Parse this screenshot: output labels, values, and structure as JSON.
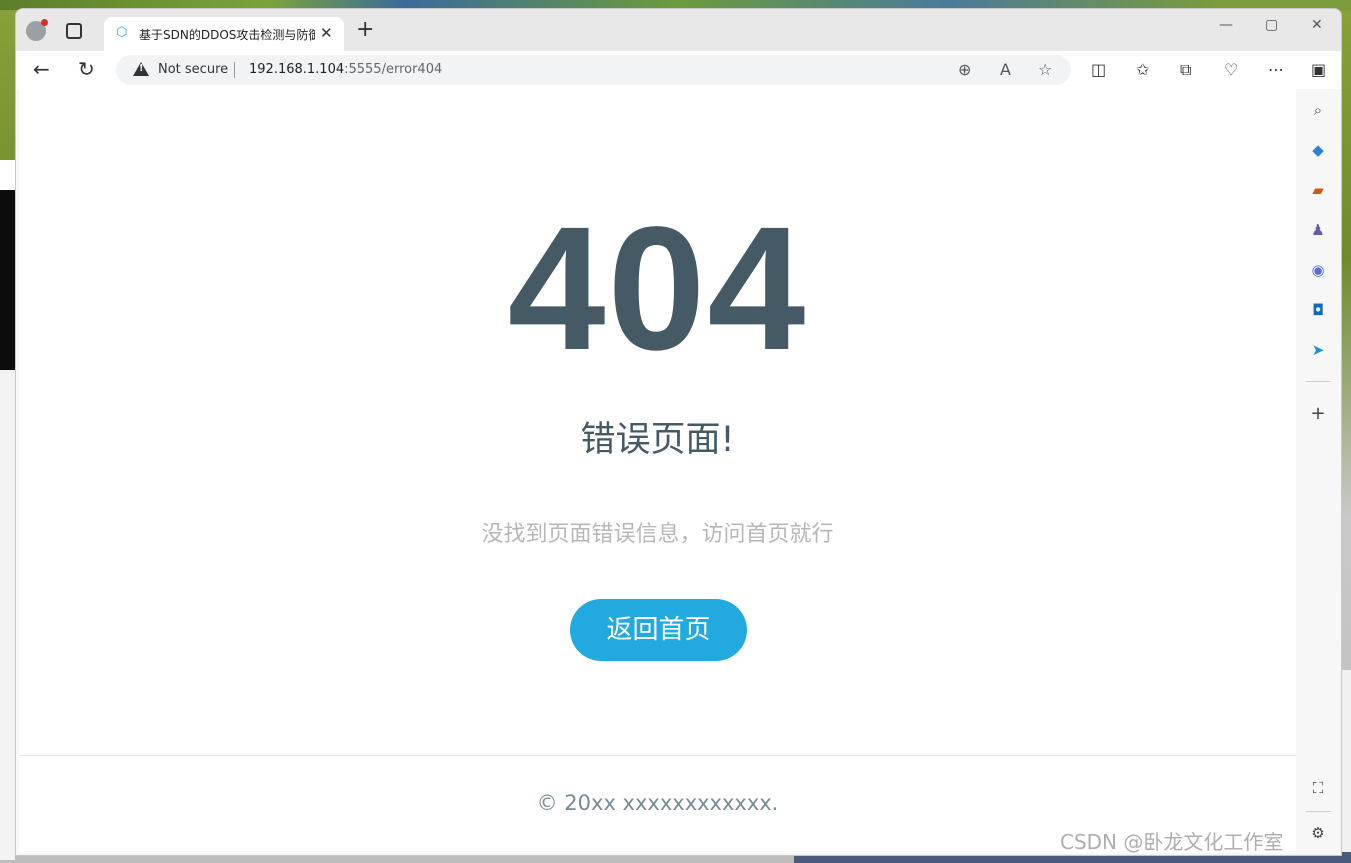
{
  "browser": {
    "tab": {
      "title": "基于SDN的DDOS攻击检测与防御",
      "close": "✕"
    },
    "new_tab": "+",
    "window_controls": {
      "minimize": "—",
      "maximize": "▢",
      "close": "✕"
    },
    "address_bar": {
      "security_label": "Not secure",
      "url_host": "192.168.1.104",
      "url_path": ":5555/error404"
    },
    "icons": {
      "back": "←",
      "refresh": "↻",
      "zoom": "⊕",
      "read_aloud": "A",
      "favorite": "☆",
      "split": "◫",
      "favorites": "✩",
      "collections": "⧉",
      "performance": "♡",
      "more": "⋯",
      "sidebar_toggle": "▣"
    }
  },
  "page": {
    "error_code": "404",
    "error_title": "错误页面!",
    "error_description": "没找到页面错误信息，访问首页就行",
    "home_button_label": "返回首页",
    "footer_text": "© 20xx xxxxxxxxxxxx."
  },
  "sidebar": {
    "items": [
      {
        "name": "search",
        "glyph": "⌕",
        "color": "#555555"
      },
      {
        "name": "shopping",
        "glyph": "◆",
        "color": "#2f7fd8"
      },
      {
        "name": "tools",
        "glyph": "▰",
        "color": "#d2541f"
      },
      {
        "name": "games",
        "glyph": "♟",
        "color": "#6b5aa8"
      },
      {
        "name": "microsoft-365",
        "glyph": "◉",
        "color": "#5a6be0"
      },
      {
        "name": "outlook",
        "glyph": "◘",
        "color": "#0f6cbd"
      },
      {
        "name": "send",
        "glyph": "➤",
        "color": "#1e90d6"
      }
    ],
    "add": "+",
    "bottom": [
      {
        "name": "screenshot",
        "glyph": "⛶"
      },
      {
        "name": "settings",
        "glyph": "⚙"
      }
    ]
  },
  "watermark": "CSDN @卧龙文化工作室",
  "colors": {
    "heading": "#455a64",
    "description": "#b7b7b7",
    "button": "#22a9e0",
    "footer": "#7a8a93"
  }
}
